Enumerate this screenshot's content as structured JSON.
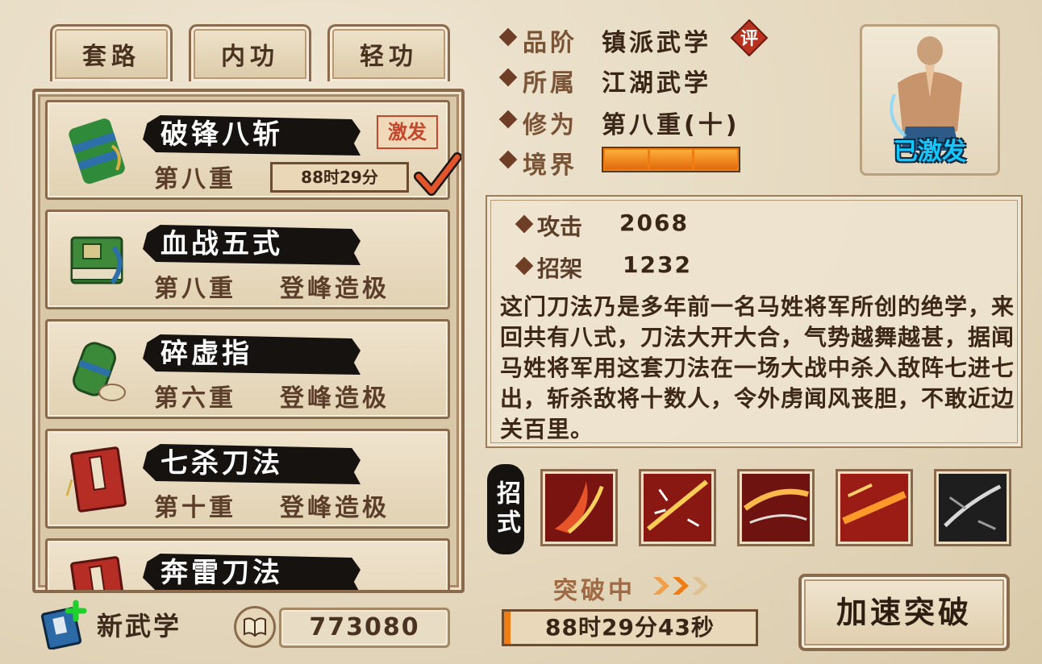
{
  "tabs": [
    {
      "label": "套路"
    },
    {
      "label": "内功"
    },
    {
      "label": "轻功"
    }
  ],
  "martial_arts": [
    {
      "name": "破锋八斩",
      "level": "第八重",
      "timer": "88时29分",
      "badge": "激发",
      "selected": true
    },
    {
      "name": "血战五式",
      "level": "第八重",
      "status": "登峰造极"
    },
    {
      "name": "碎虚指",
      "level": "第六重",
      "status": "登峰造极"
    },
    {
      "name": "七杀刀法",
      "level": "第十重",
      "status": "登峰造极"
    },
    {
      "name": "奔雷刀法"
    }
  ],
  "bottom_left": {
    "new_label": "新武学",
    "currency_value": "773080"
  },
  "info": {
    "grade_label": "品阶",
    "grade_value": "镇派武学",
    "grade_badge": "评",
    "belong_label": "所属",
    "belong_value": "江湖武学",
    "cultivation_label": "修为",
    "cultivation_value": "第八重(十)",
    "realm_label": "境界",
    "realm_segments_filled": 3,
    "realm_segments_total": 3
  },
  "portrait": {
    "status": "已激发"
  },
  "stats": {
    "attack_label": "攻击",
    "attack_value": "2068",
    "parry_label": "招架",
    "parry_value": "1232"
  },
  "description": "这门刀法乃是多年前一名马姓将军所创的绝学，来回共有八式，刀法大开大合，气势越舞越甚，据闻马姓将军用这套刀法在一场大战中杀入敌阵七进七出，斩杀敌将十数人，令外虏闻风丧胆，不敢近边关百里。",
  "moves": {
    "label": "招式",
    "count": 5
  },
  "breakthrough": {
    "label": "突破中",
    "time_left": "88时29分43秒",
    "button_label": "加速突破"
  },
  "colors": {
    "accent_orange": "#f07d14",
    "ink_black": "#161210",
    "badge_red": "#c4462b",
    "activated_cyan": "#12c8ff"
  }
}
